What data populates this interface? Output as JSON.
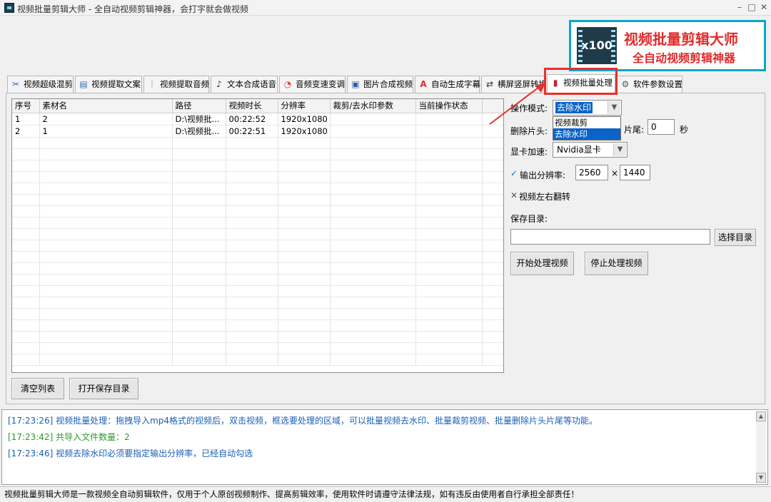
{
  "window": {
    "title": "视频批量剪辑大师 - 全自动视频剪辑神器，会打字就会做视频",
    "minimize": "–",
    "maximize": "□",
    "close": "✕"
  },
  "brand": {
    "logo_text": "x100",
    "title": "视频批量剪辑大师",
    "subtitle": "全自动视频剪辑神器"
  },
  "tabs": [
    {
      "label": "视频超级混剪",
      "icon": "scissors-icon",
      "glyph": "✂"
    },
    {
      "label": "视频提取文案",
      "icon": "document-icon",
      "glyph": "▤"
    },
    {
      "label": "视频提取音频",
      "icon": "audio-wave-icon",
      "glyph": "⦙"
    },
    {
      "label": "文本合成语音",
      "icon": "microphone-icon",
      "glyph": "♪"
    },
    {
      "label": "音频变速变调",
      "icon": "gauge-icon",
      "glyph": "◔"
    },
    {
      "label": "图片合成视频",
      "icon": "image-icon",
      "glyph": "▣"
    },
    {
      "label": "自动生成字幕",
      "icon": "text-icon",
      "glyph": "A"
    },
    {
      "label": "横屏竖屏转换",
      "icon": "rotate-screen-icon",
      "glyph": "⇄"
    },
    {
      "label": "视频批量处理",
      "icon": "film-icon",
      "glyph": "▮"
    },
    {
      "label": "软件参数设置",
      "icon": "gear-icon",
      "glyph": "⚙"
    }
  ],
  "table": {
    "columns": [
      "序号",
      "素材名",
      "路径",
      "视频时长",
      "分辨率",
      "裁剪/去水印参数",
      "当前操作状态",
      ""
    ],
    "rows": [
      [
        "1",
        "2",
        "D:\\视频批...",
        "00:22:52",
        "1920x1080",
        "",
        "",
        ""
      ],
      [
        "2",
        "1",
        "D:\\视频批...",
        "00:22:51",
        "1920x1080",
        "",
        "",
        ""
      ]
    ],
    "empty_rows": 20
  },
  "buttons": {
    "clear_list": "清空列表",
    "open_save_dir": "打开保存目录",
    "select_dir": "选择目录",
    "start": "开始处理视频",
    "stop": "停止处理视频"
  },
  "settings": {
    "mode_label": "操作模式:",
    "mode_value": "去除水印",
    "mode_options": [
      "视频裁剪",
      "去除水印"
    ],
    "trim_head_label": "删除片头:",
    "trim_tail_label": "片尾:",
    "trim_tail_value": "0",
    "seconds_unit": "秒",
    "gpu_label": "显卡加速:",
    "gpu_value": "Nvidia显卡",
    "check_mark": "✓",
    "x_mark": "✕",
    "resolution_label": "输出分辨率:",
    "res_width": "2560",
    "res_times": "×",
    "res_height": "1440",
    "flip_label": "视频左右翻转",
    "save_dir_label": "保存目录:",
    "save_dir_value": ""
  },
  "log": [
    {
      "text": "[17:23:26] 视频批量处理：拖拽导入mp4格式的视频后，双击视频，框选要处理的区域，可以批量视频去水印、批量裁剪视频、批量删除片头片尾等功能。",
      "color": "#1a5fb4"
    },
    {
      "text": "[17:23:42] 共导入文件数量：2",
      "color": "#2c9a2c"
    },
    {
      "text": "[17:23:46] 视频去除水印必须要指定输出分辨率，已经自动勾选",
      "color": "#1a5fb4"
    }
  ],
  "status_bar": "视频批量剪辑大师是一款视频全自动剪辑软件，仅用于个人原创视频制作、提高剪辑效率，使用软件时请遵守法律法规，如有违反由使用者自行承担全部责任！",
  "accent_colors": {
    "brand": "#0aa5c9",
    "highlight": "#e8302a",
    "selection": "#0a64c8"
  }
}
